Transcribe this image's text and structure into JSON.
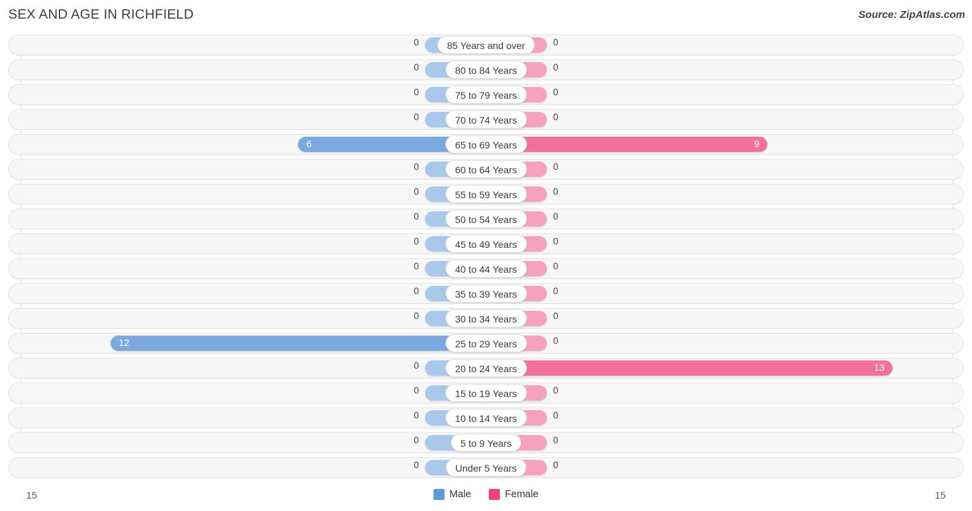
{
  "header": {
    "title": "SEX AND AGE IN RICHFIELD",
    "source": "Source: ZipAtlas.com"
  },
  "legend": {
    "male_label": "Male",
    "female_label": "Female",
    "male_color": "#5B9BD5",
    "female_color": "#F1427F"
  },
  "axis": {
    "left_max": "15",
    "right_max": "15"
  },
  "chart_data": {
    "type": "bar",
    "subtype": "population-pyramid",
    "title": "SEX AND AGE IN RICHFIELD",
    "xlabel": "",
    "ylabel": "",
    "xlim": [
      15,
      15
    ],
    "grid": true,
    "legend_position": "bottom-center",
    "categories": [
      "85 Years and over",
      "80 to 84 Years",
      "75 to 79 Years",
      "70 to 74 Years",
      "65 to 69 Years",
      "60 to 64 Years",
      "55 to 59 Years",
      "50 to 54 Years",
      "45 to 49 Years",
      "40 to 44 Years",
      "35 to 39 Years",
      "30 to 34 Years",
      "25 to 29 Years",
      "20 to 24 Years",
      "15 to 19 Years",
      "10 to 14 Years",
      "5 to 9 Years",
      "Under 5 Years"
    ],
    "series": [
      {
        "name": "Male",
        "color": "#7BA9DF",
        "values": [
          0,
          0,
          0,
          0,
          6,
          0,
          0,
          0,
          0,
          0,
          0,
          0,
          12,
          0,
          0,
          0,
          0,
          0
        ]
      },
      {
        "name": "Female",
        "color": "#F4709C",
        "values": [
          0,
          0,
          0,
          0,
          9,
          0,
          0,
          0,
          0,
          0,
          0,
          0,
          0,
          13,
          0,
          0,
          0,
          0
        ]
      }
    ]
  },
  "rows": [
    {
      "age": "85 Years and over",
      "male": "0",
      "female": "0"
    },
    {
      "age": "80 to 84 Years",
      "male": "0",
      "female": "0"
    },
    {
      "age": "75 to 79 Years",
      "male": "0",
      "female": "0"
    },
    {
      "age": "70 to 74 Years",
      "male": "0",
      "female": "0"
    },
    {
      "age": "65 to 69 Years",
      "male": "6",
      "female": "9"
    },
    {
      "age": "60 to 64 Years",
      "male": "0",
      "female": "0"
    },
    {
      "age": "55 to 59 Years",
      "male": "0",
      "female": "0"
    },
    {
      "age": "50 to 54 Years",
      "male": "0",
      "female": "0"
    },
    {
      "age": "45 to 49 Years",
      "male": "0",
      "female": "0"
    },
    {
      "age": "40 to 44 Years",
      "male": "0",
      "female": "0"
    },
    {
      "age": "35 to 39 Years",
      "male": "0",
      "female": "0"
    },
    {
      "age": "30 to 34 Years",
      "male": "0",
      "female": "0"
    },
    {
      "age": "25 to 29 Years",
      "male": "12",
      "female": "0"
    },
    {
      "age": "20 to 24 Years",
      "male": "0",
      "female": "13"
    },
    {
      "age": "15 to 19 Years",
      "male": "0",
      "female": "0"
    },
    {
      "age": "10 to 14 Years",
      "male": "0",
      "female": "0"
    },
    {
      "age": "5 to 9 Years",
      "male": "0",
      "female": "0"
    },
    {
      "age": "Under 5 Years",
      "male": "0",
      "female": "0"
    }
  ]
}
